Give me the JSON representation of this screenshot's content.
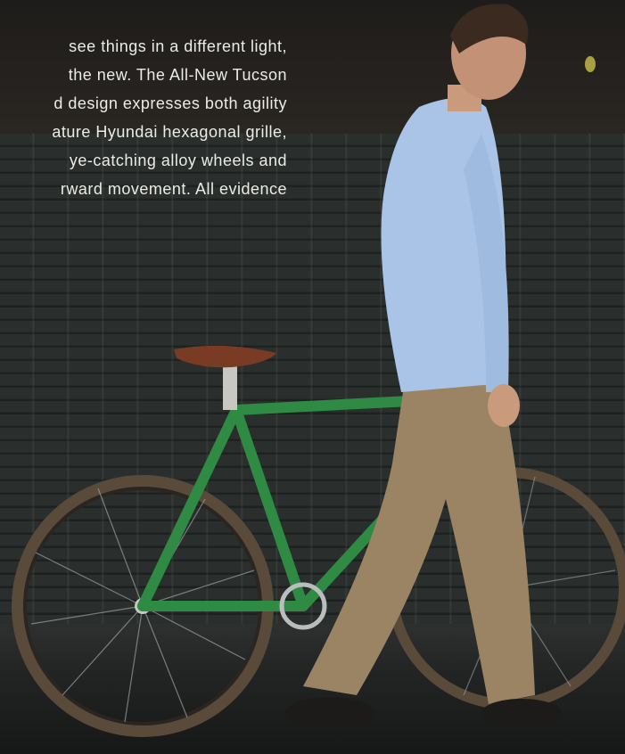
{
  "ad_copy": {
    "lines": [
      "see things in a different light,",
      "the new. The All-New Tucson",
      "d design expresses both agility",
      "ature Hyundai hexagonal grille,",
      "ye-catching alloy wheels and",
      "rward movement. All evidence"
    ]
  },
  "colors": {
    "wall": "#2b302e",
    "bike_frame": "#2f8a43",
    "shirt": "#a9c4e6",
    "trousers": "#9b8464",
    "saddle": "#7a3b25",
    "text": "#ecece6"
  }
}
